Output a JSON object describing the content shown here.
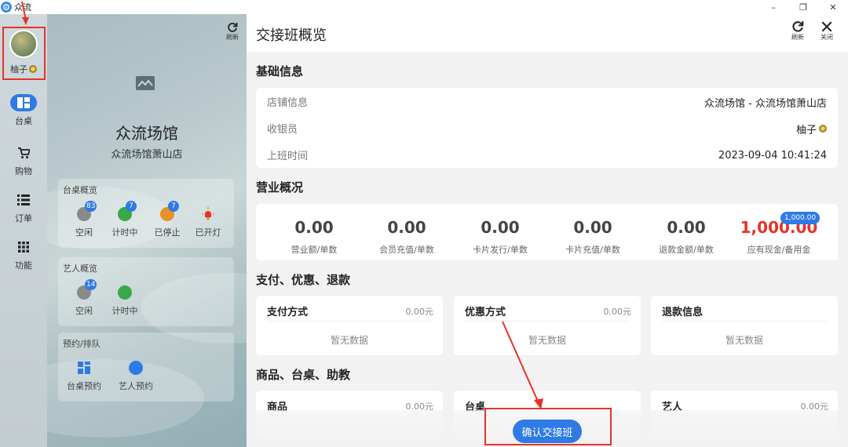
{
  "app": {
    "title": "众流"
  },
  "window": {
    "minimize": "–",
    "restore": "❐",
    "close": "✕"
  },
  "user": {
    "name": "柚子"
  },
  "nav": [
    {
      "label": "台桌",
      "icon": "dashboard-icon",
      "active": true
    },
    {
      "label": "购物",
      "icon": "cart-icon",
      "active": false
    },
    {
      "label": "订单",
      "icon": "list-icon",
      "active": false
    },
    {
      "label": "功能",
      "icon": "grid-icon",
      "active": false
    }
  ],
  "store": {
    "refresh": "刷新",
    "name": "众流场馆",
    "branch": "众流场馆萧山店"
  },
  "table_overview": {
    "title": "台桌概览",
    "stats": [
      {
        "label": "空闲",
        "count": "83",
        "color": "#8a8a8a"
      },
      {
        "label": "计时中",
        "count": "7",
        "color": "#3aa84a"
      },
      {
        "label": "已停止",
        "count": "7",
        "color": "#e8902c"
      },
      {
        "label": "已开灯",
        "count": "",
        "color": "#e63329"
      }
    ]
  },
  "artist_overview": {
    "title": "艺人概览",
    "stats": [
      {
        "label": "空闲",
        "count": "14",
        "color": "#8a8a8a"
      },
      {
        "label": "计时中",
        "count": "",
        "color": "#3aa84a"
      }
    ]
  },
  "reservation": {
    "title": "预约/排队",
    "items": [
      {
        "label": "台桌预约"
      },
      {
        "label": "艺人预约"
      }
    ]
  },
  "main": {
    "title": "交接班概览",
    "refresh": "刷新",
    "close": "关闭",
    "basic": {
      "title": "基础信息",
      "rows": [
        {
          "label": "店铺信息",
          "value": "众流场馆 - 众流场馆萧山店"
        },
        {
          "label": "收银员",
          "value": "柚子"
        },
        {
          "label": "上班时间",
          "value": "2023-09-04 10:41:24"
        }
      ]
    },
    "business": {
      "title": "营业概况",
      "metrics": [
        {
          "value": "0.00",
          "label": "营业额/单数"
        },
        {
          "value": "0.00",
          "label": "会员充值/单数"
        },
        {
          "value": "0.00",
          "label": "卡片发行/单数"
        },
        {
          "value": "0.00",
          "label": "卡片充值/单数"
        },
        {
          "value": "0.00",
          "label": "退款金额/单数"
        },
        {
          "value": "1,000.00",
          "label": "应有现金/备用金",
          "badge": "1,000.00"
        }
      ]
    },
    "payments": {
      "title": "支付、优惠、退款",
      "cards": [
        {
          "title": "支付方式",
          "amount": "0.00元",
          "empty": "暂无数据"
        },
        {
          "title": "优惠方式",
          "amount": "0.00元",
          "empty": "暂无数据"
        },
        {
          "title": "退款信息",
          "amount": "",
          "empty": "暂无数据"
        }
      ]
    },
    "goods": {
      "title": "商品、台桌、助教",
      "cards": [
        {
          "title": "商品",
          "amount": "0.00元"
        },
        {
          "title": "台桌",
          "amount": ""
        },
        {
          "title": "艺人",
          "amount": "0.00元"
        }
      ]
    },
    "confirm": "确认交接班"
  },
  "colors": {
    "accent": "#2f7ae5",
    "highlight": "#e63329"
  }
}
